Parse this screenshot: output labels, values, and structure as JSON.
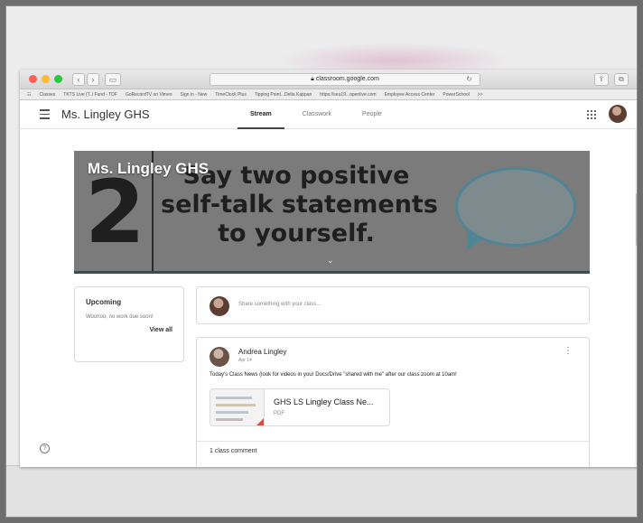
{
  "browser": {
    "url": "classroom.google.com",
    "bookmarks": [
      "Classes",
      "TKTS Live (T..l Fund - TDF",
      "GoRecordTV on Vimeo",
      "Sign in - New",
      "TimeClock Plus",
      "Tipping Point...Delta Kappan",
      "https://seu19...openlive.com",
      "Employee Access Center",
      "PowerSchool"
    ],
    "overflow": ">>"
  },
  "app": {
    "class_name": "Ms. Lingley GHS",
    "tabs": [
      {
        "label": "Stream",
        "active": true
      },
      {
        "label": "Classwork",
        "active": false
      },
      {
        "label": "People",
        "active": false
      }
    ]
  },
  "banner": {
    "title": "Ms. Lingley GHS",
    "number": "2",
    "lines": [
      "Say two positive",
      "self-talk statements",
      "to yourself."
    ]
  },
  "upcoming": {
    "title": "Upcoming",
    "subtitle": "Woohoo, no work due soon!",
    "view_all": "View all"
  },
  "share": {
    "placeholder": "Share something with your class..."
  },
  "post": {
    "author": "Andrea Lingley",
    "date": "Apr 14",
    "body": "Today's Class News (look for videos in your Docs/Drive \"shared with me\" after our class zoom at 10am!",
    "attachment_name": "GHS LS Lingley Class Ne...",
    "attachment_type": "PDF",
    "comments": "1 class comment"
  },
  "colors": {
    "banner_bg": "#7b7b7b",
    "bubble_border": "#4f8595",
    "pdf_red": "#e24a3a"
  }
}
